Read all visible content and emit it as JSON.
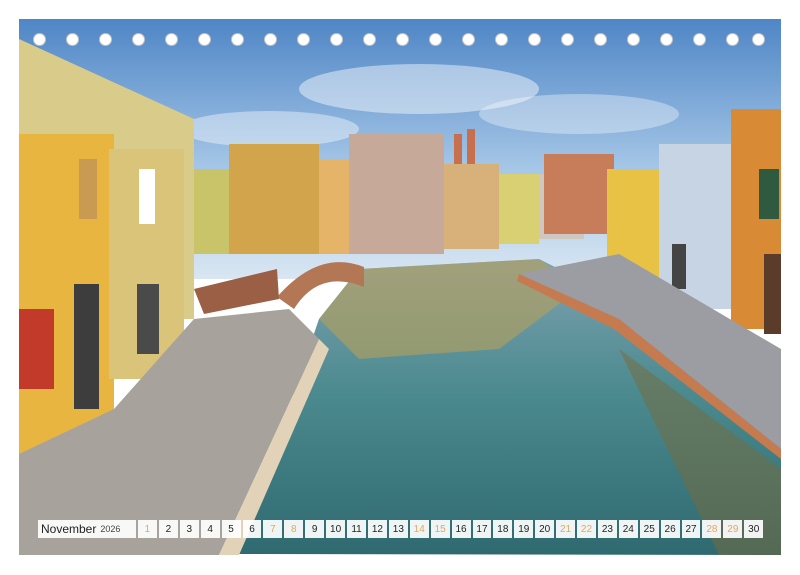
{
  "calendar": {
    "month": "November",
    "year": "2026",
    "days": [
      {
        "label": "1",
        "weekend": true
      },
      {
        "label": "2",
        "weekend": false
      },
      {
        "label": "3",
        "weekend": false
      },
      {
        "label": "4",
        "weekend": false
      },
      {
        "label": "5",
        "weekend": false
      },
      {
        "label": "6",
        "weekend": false
      },
      {
        "label": "7",
        "weekend": true
      },
      {
        "label": "8",
        "weekend": true
      },
      {
        "label": "9",
        "weekend": false
      },
      {
        "label": "10",
        "weekend": false
      },
      {
        "label": "11",
        "weekend": false
      },
      {
        "label": "12",
        "weekend": false
      },
      {
        "label": "13",
        "weekend": false
      },
      {
        "label": "14",
        "weekend": true
      },
      {
        "label": "15",
        "weekend": true
      },
      {
        "label": "16",
        "weekend": false
      },
      {
        "label": "17",
        "weekend": false
      },
      {
        "label": "18",
        "weekend": false
      },
      {
        "label": "19",
        "weekend": false
      },
      {
        "label": "20",
        "weekend": false
      },
      {
        "label": "21",
        "weekend": true
      },
      {
        "label": "22",
        "weekend": true
      },
      {
        "label": "23",
        "weekend": false
      },
      {
        "label": "24",
        "weekend": false
      },
      {
        "label": "25",
        "weekend": false
      },
      {
        "label": "26",
        "weekend": false
      },
      {
        "label": "27",
        "weekend": false
      },
      {
        "label": "28",
        "weekend": true
      },
      {
        "label": "29",
        "weekend": true
      },
      {
        "label": "30",
        "weekend": false
      }
    ]
  },
  "colors": {
    "weekend": "#e2a85f",
    "sky": "#9cc4e6",
    "water": "#3f7f8a",
    "building_yellow": "#e8b640",
    "building_orange": "#d98a34"
  }
}
